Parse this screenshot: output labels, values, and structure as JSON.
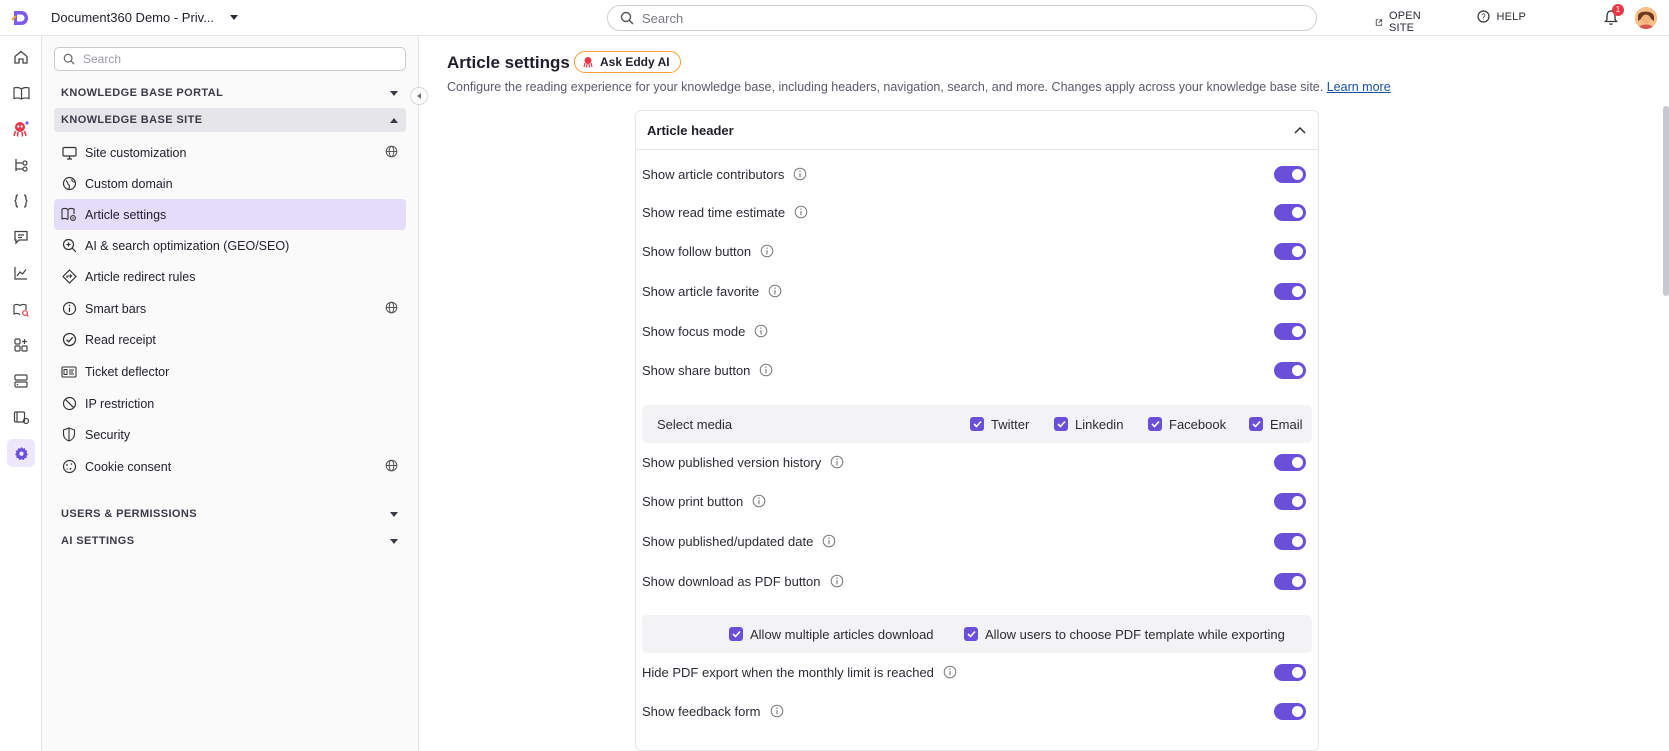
{
  "topbar": {
    "project_name": "Document360 Demo - Priv...",
    "search_placeholder": "Search",
    "open_site_label": "OPEN SITE",
    "help_label": "HELP",
    "notification_count": "1"
  },
  "sidebar": {
    "search_placeholder": "Search",
    "sections": {
      "kb_portal": "KNOWLEDGE BASE PORTAL",
      "kb_site": "KNOWLEDGE BASE SITE",
      "users": "USERS & PERMISSIONS",
      "ai": "AI SETTINGS"
    },
    "items": [
      {
        "label": "Site customization",
        "icon": "monitor-icon",
        "globe": true
      },
      {
        "label": "Custom domain",
        "icon": "globe-link-icon",
        "globe": false
      },
      {
        "label": "Article settings",
        "icon": "article-settings-icon",
        "globe": false,
        "active": true
      },
      {
        "label": "AI & search optimization (GEO/SEO)",
        "icon": "search-plus-icon",
        "globe": false
      },
      {
        "label": "Article redirect rules",
        "icon": "redirect-icon",
        "globe": false
      },
      {
        "label": "Smart bars",
        "icon": "info-icon",
        "globe": true
      },
      {
        "label": "Read receipt",
        "icon": "check-circle-icon",
        "globe": false
      },
      {
        "label": "Ticket deflector",
        "icon": "ticket-icon",
        "globe": false
      },
      {
        "label": "IP restriction",
        "icon": "block-icon",
        "globe": false
      },
      {
        "label": "Security",
        "icon": "shield-icon",
        "globe": false
      },
      {
        "label": "Cookie consent",
        "icon": "cookie-icon",
        "globe": true
      }
    ]
  },
  "main": {
    "title": "Article settings",
    "ask_eddy_label": "Ask Eddy AI",
    "description": "Configure the reading experience for your knowledge base, including headers, navigation, search, and more. Changes apply across your knowledge base site.",
    "learn_more": "Learn more",
    "card_title": "Article header",
    "settings": [
      {
        "label": "Show article contributors",
        "enabled": true
      },
      {
        "label": "Show read time estimate",
        "enabled": true
      },
      {
        "label": "Show follow button",
        "enabled": true
      },
      {
        "label": "Show article favorite",
        "enabled": true
      },
      {
        "label": "Show focus mode",
        "enabled": true
      },
      {
        "label": "Show share button",
        "enabled": true
      },
      {
        "label": "Show published version history",
        "enabled": true
      },
      {
        "label": "Show print button",
        "enabled": true
      },
      {
        "label": "Show published/updated date",
        "enabled": true
      },
      {
        "label": "Show download as PDF button",
        "enabled": true
      },
      {
        "label": "Hide PDF export when the monthly limit is reached",
        "enabled": true
      },
      {
        "label": "Show feedback form",
        "enabled": true
      }
    ],
    "select_media": {
      "label": "Select media",
      "options": [
        "Twitter",
        "Linkedin",
        "Facebook",
        "Email"
      ]
    },
    "pdf_options": [
      "Allow multiple articles download",
      "Allow users to choose PDF template while exporting"
    ]
  },
  "colors": {
    "accent": "#6b4fd8",
    "active_nav_bg": "#e4dcf8",
    "eddy_border": "#f0a030",
    "link": "#1b4fa3"
  }
}
